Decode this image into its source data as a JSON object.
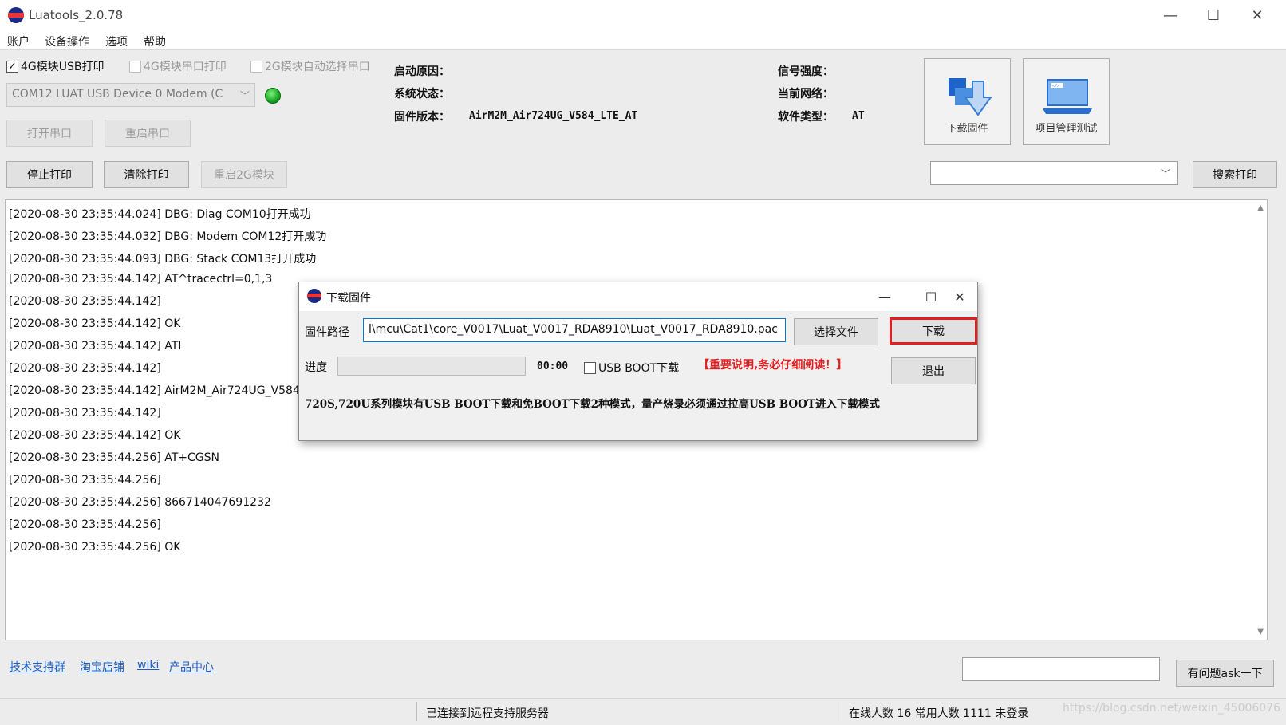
{
  "window": {
    "title": "Luatools_2.0.78",
    "min": "—",
    "max": "☐",
    "close": "✕"
  },
  "menu": [
    "账户",
    "设备操作",
    "选项",
    "帮助"
  ],
  "checkboxes": [
    {
      "label": "4G模块USB打印",
      "checked": true,
      "check": "✓"
    },
    {
      "label": "4G模块串口打印",
      "checked": false
    },
    {
      "label": "2G模块自动选择串口",
      "checked": false
    }
  ],
  "port": {
    "value": "COM12 LUAT USB Device 0 Modem (C",
    "arrow": "﹀"
  },
  "buttons": {
    "open_port": "打开串口",
    "restart_port": "重启串口",
    "stop_print": "停止打印",
    "clear_print": "清除打印",
    "restart_2g": "重启2G模块",
    "search_print": "搜索打印",
    "ask": "有问题ask一下"
  },
  "info": {
    "boot_reason": {
      "label": "启动原因：",
      "value": ""
    },
    "sys_status": {
      "label": "系统状态：",
      "value": ""
    },
    "fw_version": {
      "label": "固件版本：",
      "value": "AirM2M_Air724UG_V584_LTE_AT"
    },
    "signal": {
      "label": "信号强度：",
      "value": ""
    },
    "network": {
      "label": "当前网络：",
      "value": ""
    },
    "sw_type": {
      "label": "软件类型：",
      "value": "AT"
    }
  },
  "tools": {
    "download_fw": "下载固件",
    "project_test": "项目管理测试"
  },
  "search": {
    "arrow": "﹀"
  },
  "log": [
    "[2020-08-30 23:35:44.024] DBG: Diag COM10打开成功",
    "[2020-08-30 23:35:44.032] DBG: Modem COM12打开成功",
    "[2020-08-30 23:35:44.093] DBG: Stack COM13打开成功",
    "[2020-08-30 23:35:44.142] AT^tracectrl=0,1,3",
    "[2020-08-30 23:35:44.142]",
    "[2020-08-30 23:35:44.142] OK",
    "[2020-08-30 23:35:44.142] ATI",
    "[2020-08-30 23:35:44.142]",
    "[2020-08-30 23:35:44.142] AirM2M_Air724UG_V584",
    "[2020-08-30 23:35:44.142]",
    "[2020-08-30 23:35:44.142] OK",
    "[2020-08-30 23:35:44.256] AT+CGSN",
    "[2020-08-30 23:35:44.256]",
    "[2020-08-30 23:35:44.256] 866714047691232",
    "[2020-08-30 23:35:44.256]",
    "[2020-08-30 23:35:44.256] OK"
  ],
  "dialog": {
    "title": "下载固件",
    "path_label": "固件路径",
    "path_value": "l\\mcu\\Cat1\\core_V0017\\Luat_V0017_RDA8910\\Luat_V0017_RDA8910.pac",
    "select_file": "选择文件",
    "download": "下载",
    "progress_label": "进度",
    "time": "00:00",
    "usb_boot": "USB BOOT下载",
    "important": "【重要说明,务必仔细阅读！】",
    "exit": "退出",
    "note": "720S,720U系列模块有USB BOOT下载和免BOOT下载2种模式，量产烧录必须通过拉高USB BOOT进入下载模式",
    "min": "—",
    "max": "☐",
    "close": "✕"
  },
  "links": [
    "技术支持群",
    "淘宝店铺",
    "wiki",
    "产品中心"
  ],
  "status": {
    "server": "已连接到远程支持服务器",
    "users": "在线人数 16 常用人数 1111 未登录"
  },
  "watermark": "https://blog.csdn.net/weixin_45006076",
  "colors": {
    "highlight": "#e02020",
    "link": "#1a5fc9",
    "led": "#18b42a"
  }
}
